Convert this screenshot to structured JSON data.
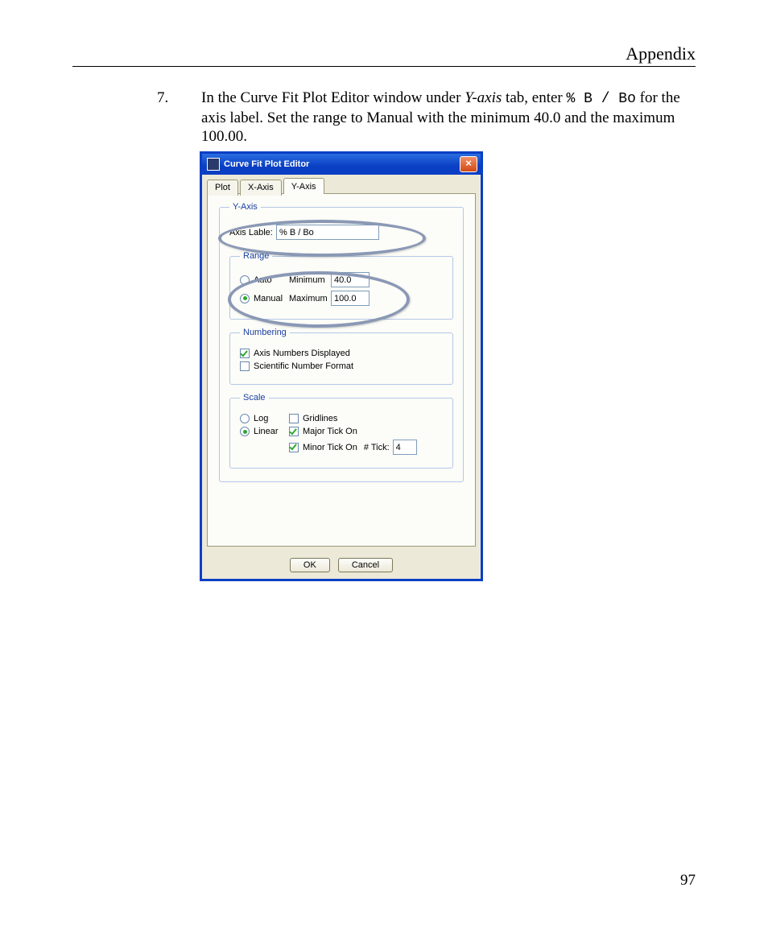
{
  "header": {
    "title": "Appendix"
  },
  "step": {
    "number": "7.",
    "text_pre": "In the Curve Fit Plot Editor window under ",
    "yaxis_label": "Y-axis",
    "text_mid": " tab, enter ",
    "code": "% B / Bo",
    "text_post": " for the axis label. Set the range to Manual with the minimum 40.0 and the maximum 100.00."
  },
  "dialog": {
    "title": "Curve Fit Plot Editor",
    "close_glyph": "×",
    "tabs": {
      "plot": "Plot",
      "xaxis": "X-Axis",
      "yaxis": "Y-Axis"
    },
    "groups": {
      "yaxis_legend": "Y-Axis",
      "range_legend": "Range",
      "numbering_legend": "Numbering",
      "scale_legend": "Scale"
    },
    "axis_lable_label": "Axis Lable:",
    "axis_lable_value": "% B / Bo",
    "range": {
      "auto": "Auto",
      "manual": "Manual",
      "min_label": "Minimum",
      "max_label": "Maximum",
      "min_value": "40.0",
      "max_value": "100.0"
    },
    "numbering": {
      "axis_numbers": "Axis Numbers Displayed",
      "scientific": "Scientific Number Format"
    },
    "scale": {
      "log": "Log",
      "linear": "Linear",
      "gridlines": "Gridlines",
      "major_tick": "Major Tick On",
      "minor_tick": "Minor Tick On",
      "num_tick_label": "# Tick:",
      "num_tick_value": "4"
    },
    "buttons": {
      "ok": "OK",
      "cancel": "Cancel"
    }
  },
  "page_number": "97"
}
